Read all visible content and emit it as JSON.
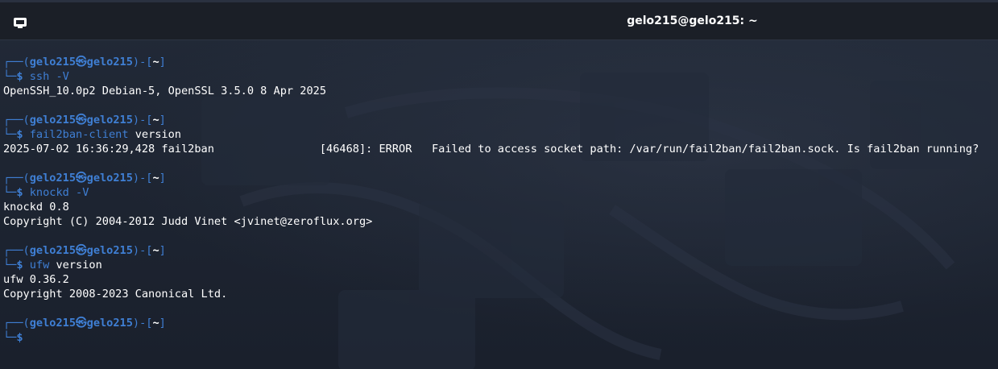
{
  "window": {
    "title": "gelo215@gelo215: ~",
    "tab_icon": "terminal-tab-icon"
  },
  "prompt": {
    "top_prefix": "┌──(",
    "user_host": "gelo215㉿gelo215",
    "mid": ")-[",
    "dir": "~",
    "end": "]",
    "bottom_prefix": "└─",
    "symbol": "$"
  },
  "blocks": [
    {
      "command": "ssh",
      "args": " -V",
      "args_is_option": true,
      "output": [
        "OpenSSH_10.0p2 Debian-5, OpenSSL 3.5.0 8 Apr 2025"
      ]
    },
    {
      "command": "fail2ban-client",
      "args": " version",
      "args_is_option": false,
      "output": [
        "2025-07-02 16:36:29,428 fail2ban                [46468]: ERROR   Failed to access socket path: /var/run/fail2ban/fail2ban.sock. Is fail2ban running?"
      ]
    },
    {
      "command": "knockd",
      "args": " -V",
      "args_is_option": true,
      "output": [
        "knockd 0.8",
        "Copyright (C) 2004-2012 Judd Vinet <jvinet@zeroflux.org>"
      ]
    },
    {
      "command": "ufw",
      "args": " version",
      "args_is_option": false,
      "output": [
        "ufw 0.36.2",
        "Copyright 2008-2023 Canonical Ltd."
      ]
    }
  ],
  "colors": {
    "prompt_blue": "#3f7fd4",
    "text": "#ffffff",
    "titlebar": "#1b1f27"
  }
}
